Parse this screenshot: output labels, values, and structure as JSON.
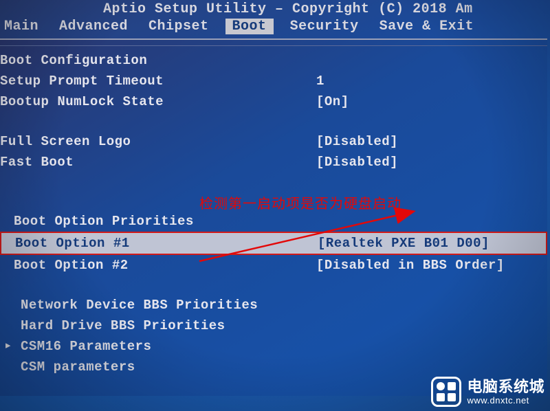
{
  "header": {
    "title": "Aptio Setup Utility – Copyright (C) 2018 Am"
  },
  "menu": {
    "items": [
      {
        "label": "Main"
      },
      {
        "label": "Advanced"
      },
      {
        "label": "Chipset"
      },
      {
        "label": "Boot",
        "active": true
      },
      {
        "label": "Security"
      },
      {
        "label": "Save & Exit"
      }
    ]
  },
  "panel": {
    "section_title": "Boot Configuration",
    "setup_prompt_label": "Setup Prompt Timeout",
    "setup_prompt_value": "1",
    "numlock_label": "Bootup NumLock State",
    "numlock_value": "[On]",
    "fslogo_label": "Full Screen Logo",
    "fslogo_value": "[Disabled]",
    "fastboot_label": "Fast Boot",
    "fastboot_value": "[Disabled]",
    "priorities_title": "Boot Option Priorities",
    "opt1_label": "Boot Option #1",
    "opt1_value": "[Realtek PXE B01 D00]",
    "opt2_label": "Boot Option #2",
    "opt2_value": "[Disabled in BBS Order]",
    "net_bbs_label": "Network Device BBS Priorities",
    "hdd_bbs_label": "Hard Drive BBS Priorities",
    "csm16_label": "CSM16 Parameters",
    "csm_label": "CSM parameters"
  },
  "annotation": {
    "text": "检测第一启动项是否为硬盘启动",
    "color": "#e30808"
  },
  "watermark": {
    "main": "电脑系统城",
    "sub": "www.dnxtc.net"
  }
}
